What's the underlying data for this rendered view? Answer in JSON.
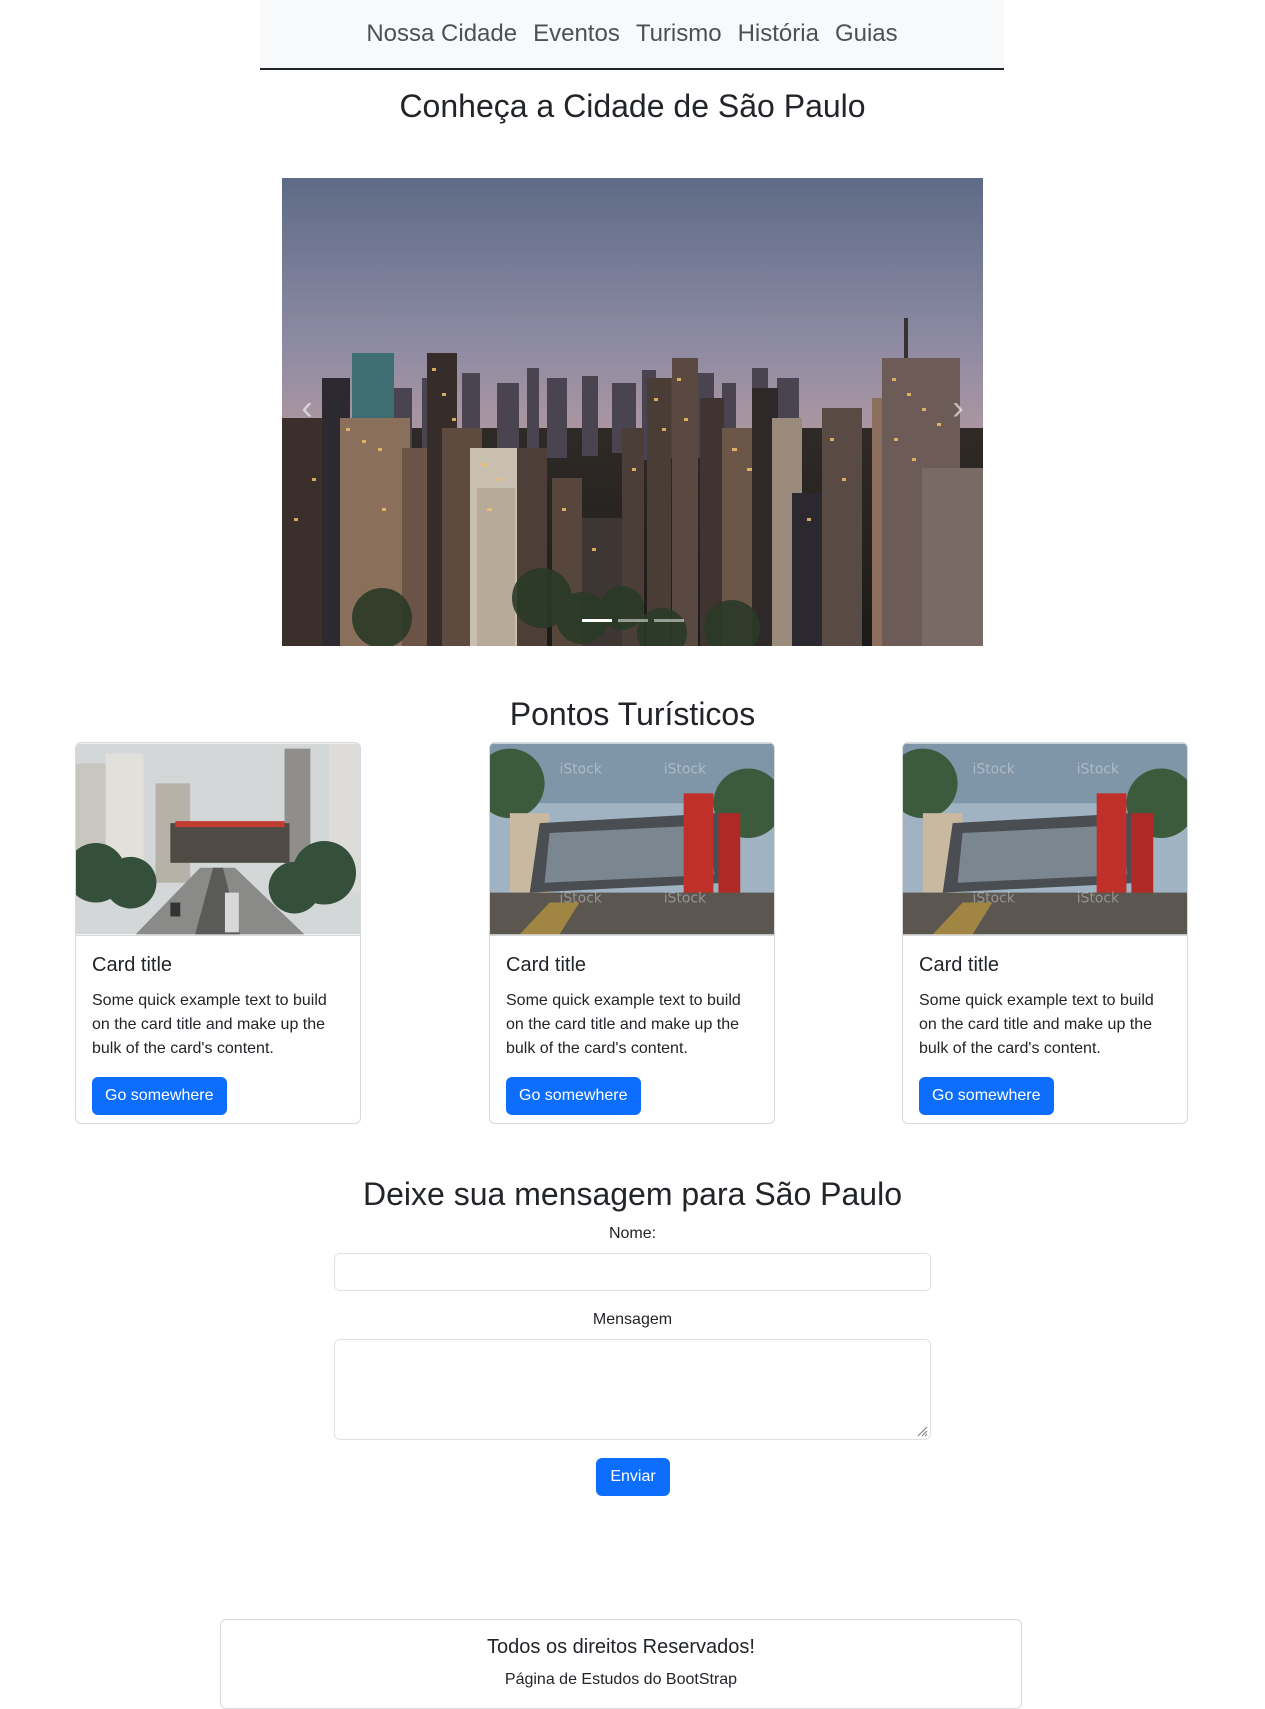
{
  "nav": {
    "items": [
      "Nossa Cidade",
      "Eventos",
      "Turismo",
      "História",
      "Guias"
    ]
  },
  "hero": {
    "title": "Conheça a Cidade de São Paulo",
    "carousel": {
      "slides": 3,
      "active_slide": 1
    }
  },
  "attractions": {
    "title": "Pontos Turísticos",
    "cards": [
      {
        "title": "Card title",
        "text": "Some quick example text to build on the card title and make up the bulk of the card's content.",
        "button": "Go somewhere"
      },
      {
        "title": "Card title",
        "text": "Some quick example text to build on the card title and make up the bulk of the card's content.",
        "button": "Go somewhere"
      },
      {
        "title": "Card title",
        "text": "Some quick example text to build on the card title and make up the bulk of the card's content.",
        "button": "Go somewhere"
      }
    ]
  },
  "form": {
    "title": "Deixe sua mensagem para São Paulo",
    "name_label": "Nome:",
    "name_value": "",
    "message_label": "Mensagem",
    "message_value": "",
    "submit_label": "Enviar"
  },
  "footer": {
    "title": "Todos os direitos Reservados!",
    "subtitle": "Página de Estudos do BootStrap"
  },
  "colors": {
    "primary": "#0d6efd",
    "nav_bg": "#f8f9fa",
    "text": "#212529"
  }
}
